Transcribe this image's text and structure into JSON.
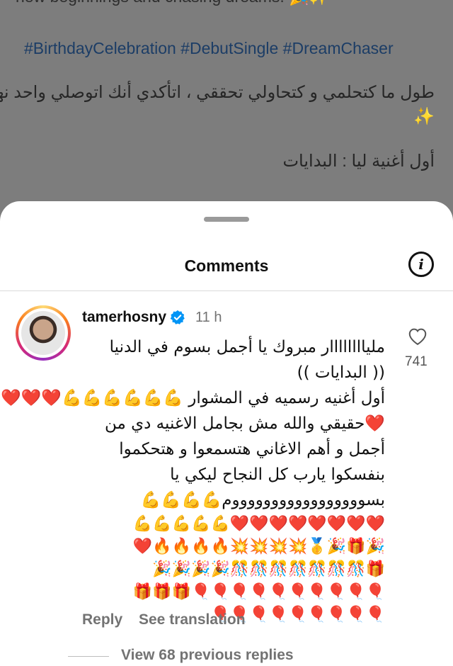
{
  "post": {
    "partial_line": "new beginnings and chasing dreams. 🎉✨",
    "hashtags": "#BirthdayCelebration #DebutSingle #DreamChaser",
    "arabic_line_1": "طول ما كتحلمي و كتحاولي تحققي ، اتأكدي أنك اتوصلي واحد نهار",
    "arabic_line_2": "✨",
    "arabic_line_3": "أول أغنية ليا : البدايات"
  },
  "sheet": {
    "title": "Comments",
    "info_icon": "info-icon"
  },
  "comment": {
    "username": "tamerhosny",
    "verified_icon": "verified-badge-icon",
    "time": "11 h",
    "lines": [
      "ملياااااااار مبروك يا أجمل بسوم في الدنيا",
      "(( البدايات ))",
      "أول أغنيه رسميه في المشوار 💪💪💪💪💪💪❤️❤️❤️",
      "❤️حقيقي والله مش بجامل الاغنيه دي من",
      "أجمل و أهم الاغاني  هتسمعوا و هتحكموا",
      "بنفسكوا يارب كل النجاح ليكي يا",
      "بسوووووووووووووووووم💪💪💪💪",
      "❤️❤️❤️❤️❤️❤️❤️❤️💪💪💪💪💪",
      "🎉🎁🎉🥇💥💥💥💥🔥🔥🔥🔥❤️",
      "🎁🎊🎊🎊🎊🎊🎊🎊🎉🎉🎉🎉",
      "🎈🎈🎈🎈🎈🎈🎈🎈🎈🎈🎁🎁🎁",
      "🎈🎈🎈🎈🎈🎈🎈🎈🎈"
    ],
    "like_icon": "heart-icon",
    "like_count": "741",
    "reply_label": "Reply",
    "translate_label": "See translation",
    "view_replies_label": "View 68 previous replies"
  }
}
